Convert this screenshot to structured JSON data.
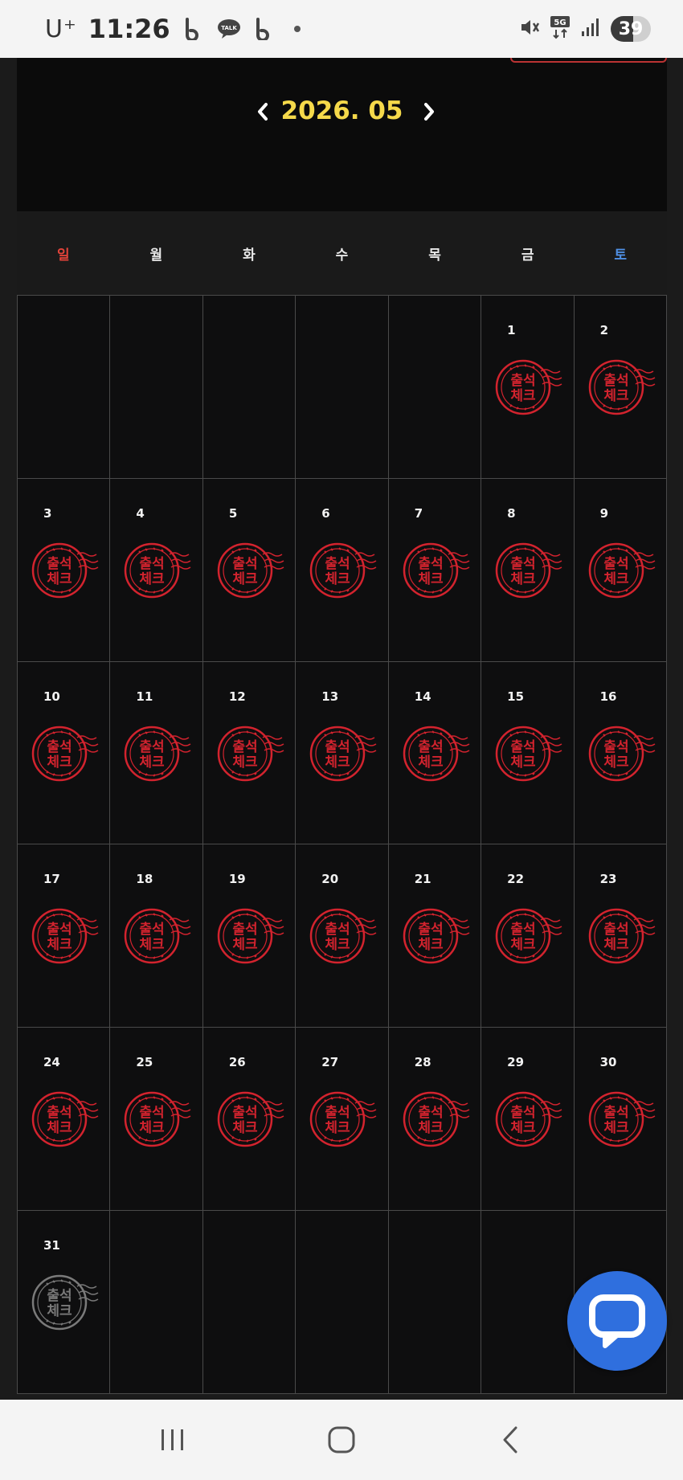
{
  "status_bar": {
    "carrier": "U⁺",
    "time": "11:26",
    "battery": "39",
    "network": "5G",
    "icons": [
      "band-app-icon",
      "kakaotalk-icon",
      "band-app-icon",
      "notification-dot",
      "mute-icon",
      "5g-icon",
      "signal-icon",
      "battery-icon"
    ]
  },
  "calendar": {
    "title": "2026. 05",
    "prev_label": "‹",
    "next_label": "›",
    "weekdays": [
      "일",
      "월",
      "화",
      "수",
      "목",
      "금",
      "토"
    ],
    "stamp_text_line1": "출석",
    "stamp_text_line2": "체크",
    "days": [
      "",
      "",
      "",
      "",
      "",
      "1",
      "2",
      "3",
      "4",
      "5",
      "6",
      "7",
      "8",
      "9",
      "10",
      "11",
      "12",
      "13",
      "14",
      "15",
      "16",
      "17",
      "18",
      "19",
      "20",
      "21",
      "22",
      "23",
      "24",
      "25",
      "26",
      "27",
      "28",
      "29",
      "30",
      "31",
      "",
      "",
      "",
      "",
      "",
      ""
    ],
    "stamp_state_note_colors": {
      "checked": "#d3232e",
      "unchecked": "#7a7a7a"
    },
    "checked_days": [
      "1",
      "2",
      "3",
      "4",
      "5",
      "6",
      "7",
      "8",
      "9",
      "10",
      "11",
      "12",
      "13",
      "14",
      "15",
      "16",
      "17",
      "18",
      "19",
      "20",
      "21",
      "22",
      "23",
      "24",
      "25",
      "26",
      "27",
      "28",
      "29",
      "30"
    ],
    "unchecked_days": [
      "31"
    ]
  },
  "colors": {
    "title": "#f5d94a",
    "sunday": "#e2433a",
    "saturday": "#4f8fe3",
    "chat_button": "#2f6fde"
  },
  "chat_button": {
    "icon": "chat-bubble-icon"
  },
  "nav_bar": {
    "icons": [
      "recent-apps-icon",
      "home-icon",
      "back-icon"
    ]
  }
}
